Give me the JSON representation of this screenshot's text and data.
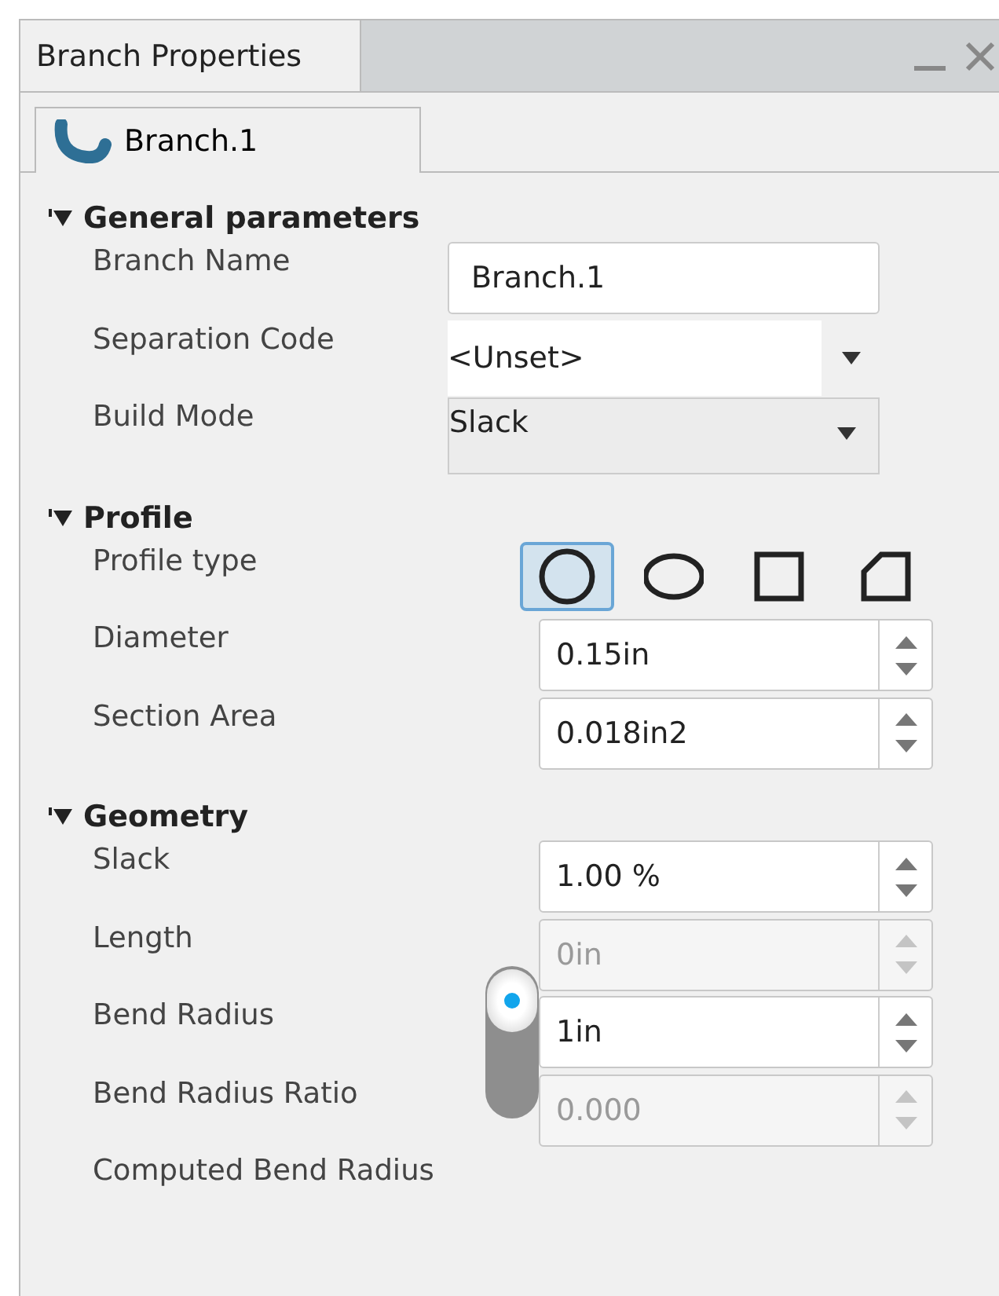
{
  "window": {
    "title": "Branch Properties",
    "controls": [
      {
        "kind": "minimize"
      },
      {
        "kind": "close"
      }
    ]
  },
  "tabs": [
    {
      "label": "Branch.1",
      "selected": true
    }
  ],
  "sections": [
    {
      "title": "General parameters",
      "expanded": true,
      "rows": [
        {
          "kind": "text",
          "label": "Branch Name",
          "value": "Branch.1"
        },
        {
          "kind": "combo",
          "label": "Separation Code",
          "value": "<Unset>"
        },
        {
          "kind": "select",
          "label": "Build Mode",
          "value": "Slack"
        }
      ]
    },
    {
      "title": "Profile",
      "expanded": true,
      "rows": [
        {
          "kind": "shapes",
          "label": "Profile type",
          "options": [
            {
              "kind": "circle",
              "selected": true
            },
            {
              "kind": "ellipse",
              "selected": false
            },
            {
              "kind": "square",
              "selected": false
            },
            {
              "kind": "chamfer",
              "selected": false
            }
          ]
        },
        {
          "kind": "spin",
          "label": "Diameter",
          "value": "0.15in",
          "disabled": false
        },
        {
          "kind": "spin",
          "label": "Section Area",
          "value": "0.018in2",
          "disabled": false
        }
      ]
    },
    {
      "title": "Geometry",
      "expanded": true,
      "bend_switch": {
        "on": true
      },
      "rows": [
        {
          "kind": "spin",
          "label": "Slack",
          "value": "1.00 %",
          "disabled": false
        },
        {
          "kind": "spin",
          "label": "Length",
          "value": "0in",
          "disabled": true
        },
        {
          "kind": "spin",
          "label": "Bend Radius",
          "value": "1in",
          "disabled": false
        },
        {
          "kind": "spin",
          "label": "Bend Radius Ratio",
          "value": "0.000",
          "disabled": true
        },
        {
          "kind": "label",
          "label": "Computed Bend Radius"
        }
      ]
    }
  ]
}
